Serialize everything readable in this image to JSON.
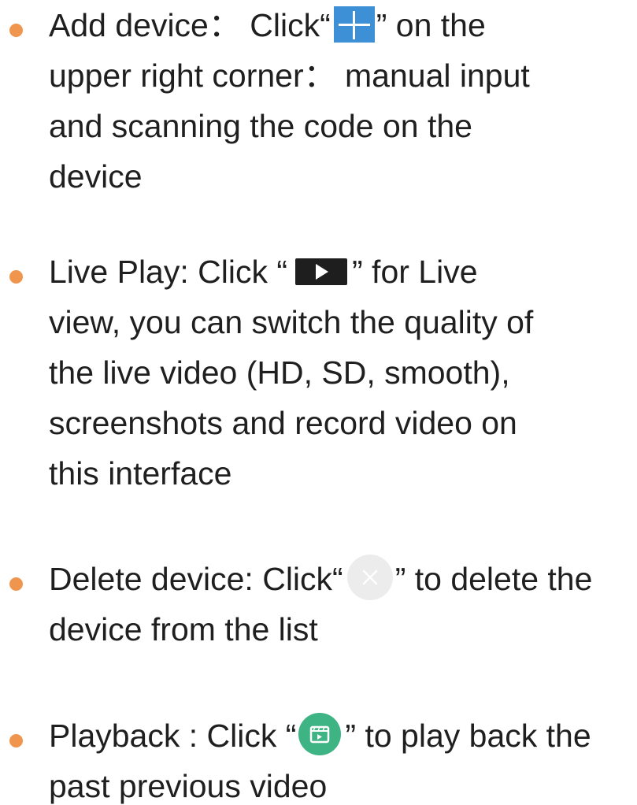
{
  "items": [
    {
      "lines": [
        [
          "Add device： Click“",
          "” on the"
        ],
        [
          "upper right corner： manual input"
        ],
        [
          "and scanning the code on the"
        ],
        [
          "device"
        ]
      ],
      "icon": "plus-icon"
    },
    {
      "lines": [
        [
          "Live Play: Click “",
          "”  for Live"
        ],
        [
          "view, you can switch the quality of"
        ],
        [
          "the live video (HD, SD, smooth),"
        ],
        [
          "screenshots and record video on"
        ],
        [
          "this interface"
        ]
      ],
      "icon": "play-icon"
    },
    {
      "lines": [
        [
          "Delete device: Click“",
          "” to delete the"
        ],
        [
          "device from the list"
        ]
      ],
      "icon": "close-icon"
    },
    {
      "lines": [
        [
          "Playback : Click “",
          "” to play back the"
        ],
        [
          "past previous video"
        ]
      ],
      "icon": "playback-icon"
    }
  ],
  "colors": {
    "bullet": "#f0954e",
    "plus_bg": "#3d8fd6",
    "play_bg": "#1e1e1e",
    "close_bg": "#ececec",
    "playback_bg": "#3eb383",
    "text": "#1f1f1f"
  }
}
